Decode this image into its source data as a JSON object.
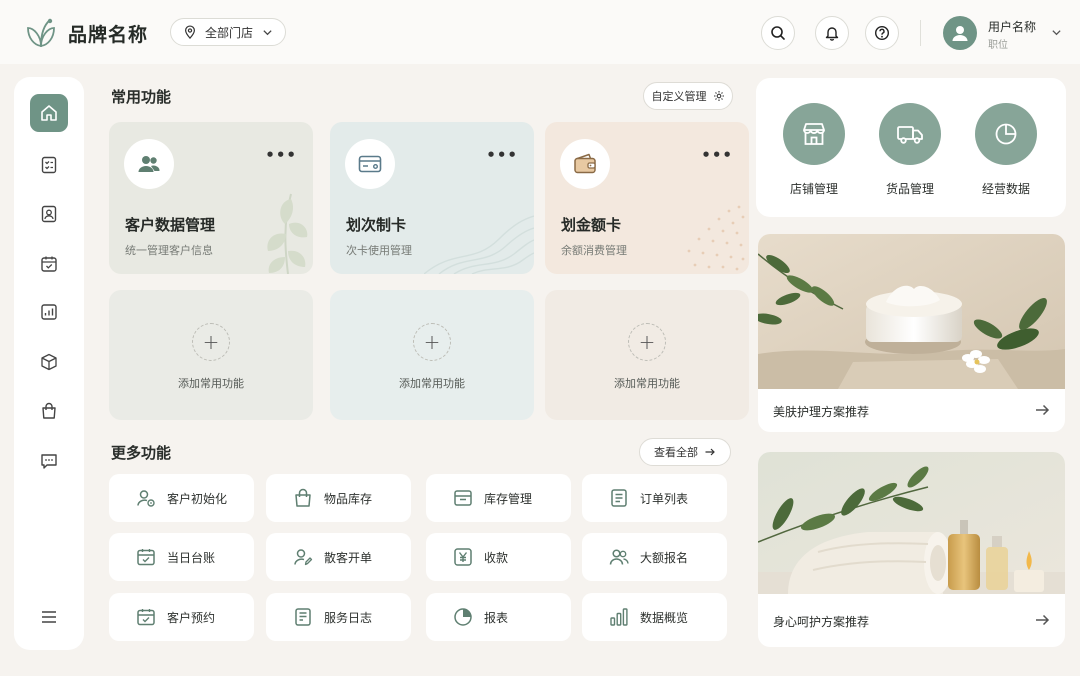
{
  "header": {
    "brand": "品牌名称",
    "store_select": "全部门店",
    "user_name": "用户名称",
    "user_role": "职位"
  },
  "colors": {
    "accent": "#6f9486",
    "accent_light": "#87a598",
    "background": "#f6f3ef"
  },
  "sidebar": {
    "items": [
      {
        "icon": "home-icon",
        "active": true
      },
      {
        "icon": "checklist-icon"
      },
      {
        "icon": "user-badge-icon"
      },
      {
        "icon": "calendar-icon"
      },
      {
        "icon": "chart-icon"
      },
      {
        "icon": "box-icon"
      },
      {
        "icon": "bag-icon"
      },
      {
        "icon": "message-icon"
      }
    ],
    "menu_icon": "menu-icon"
  },
  "common": {
    "title": "常用功能",
    "customize_label": "自定义管理",
    "cards": [
      {
        "title": "客户数据管理",
        "subtitle": "统一管理客户信息",
        "icon": "users-icon"
      },
      {
        "title": "划次制卡",
        "subtitle": "次卡使用管理",
        "icon": "card-icon"
      },
      {
        "title": "划金额卡",
        "subtitle": "余额消费管理",
        "icon": "wallet-icon"
      }
    ],
    "more_symbol": "•••",
    "add_symbol": "+",
    "add_label": "添加常用功能"
  },
  "more": {
    "title": "更多功能",
    "view_all_label": "查看全部",
    "items": [
      {
        "label": "客户初始化",
        "icon": "user-setting-icon"
      },
      {
        "label": "物品库存",
        "icon": "shopping-bag-icon"
      },
      {
        "label": "库存管理",
        "icon": "inventory-icon"
      },
      {
        "label": "订单列表",
        "icon": "order-list-icon"
      },
      {
        "label": "当日台账",
        "icon": "calendar-check-icon"
      },
      {
        "label": "散客开单",
        "icon": "user-edit-icon"
      },
      {
        "label": "收款",
        "icon": "yen-icon"
      },
      {
        "label": "大额报名",
        "icon": "users-icon"
      },
      {
        "label": "客户预约",
        "icon": "calendar-check-icon"
      },
      {
        "label": "服务日志",
        "icon": "log-icon"
      },
      {
        "label": "报表",
        "icon": "pie-chart-icon"
      },
      {
        "label": "数据概览",
        "icon": "bar-chart-icon"
      }
    ]
  },
  "quick": {
    "items": [
      {
        "label": "店铺管理",
        "icon": "store-icon"
      },
      {
        "label": "货品管理",
        "icon": "truck-icon"
      },
      {
        "label": "经营数据",
        "icon": "pie-chart-icon"
      }
    ]
  },
  "promos": [
    {
      "caption": "美肤护理方案推荐"
    },
    {
      "caption": "身心呵护方案推荐"
    }
  ]
}
